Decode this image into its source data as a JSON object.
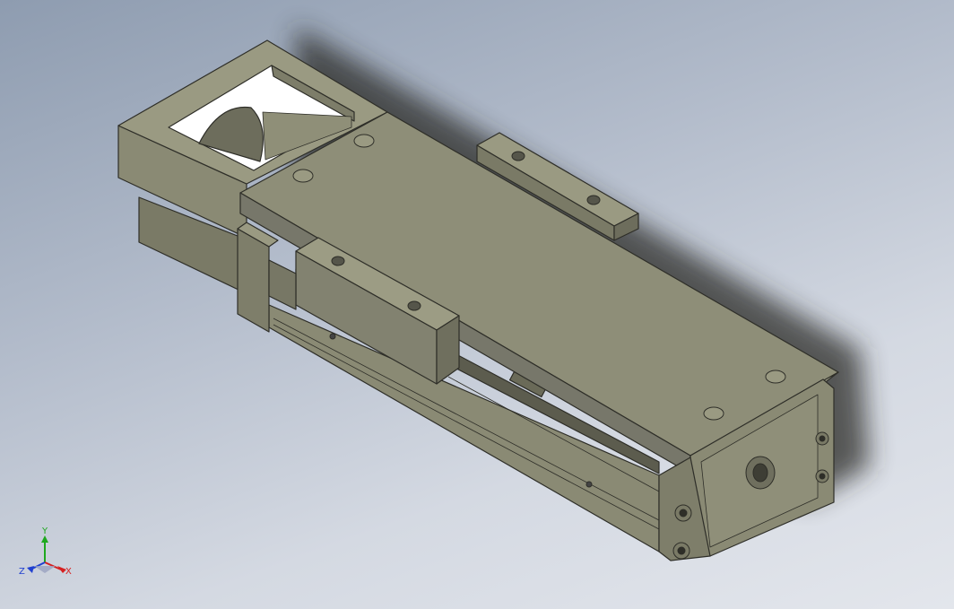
{
  "viewport": {
    "background_top": "#8e9cb0",
    "background_bottom": "#e3e6ec",
    "model_color": "#8b8b74",
    "model_dark": "#6f6f5e",
    "model_light": "#a4a48c",
    "edge_color": "#2e2e28"
  },
  "triad": {
    "x_label": "X",
    "y_label": "Y",
    "z_label": "Z",
    "x_color": "#d62020",
    "y_color": "#1ea81e",
    "z_color": "#2040d0"
  }
}
